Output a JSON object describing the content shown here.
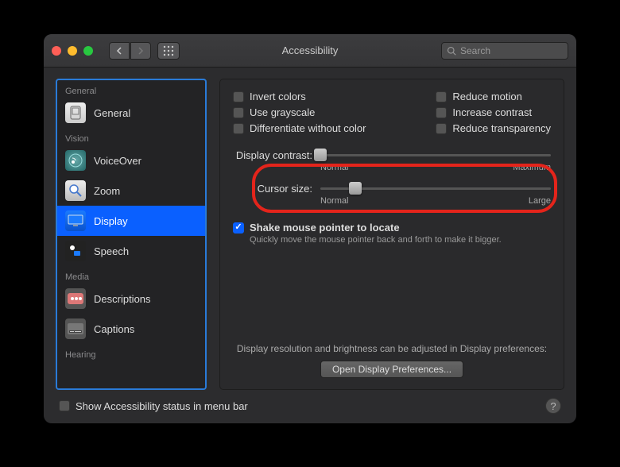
{
  "window": {
    "title": "Accessibility"
  },
  "search": {
    "placeholder": "Search"
  },
  "sidebar": {
    "sections": [
      {
        "header": "General",
        "items": [
          {
            "label": "General",
            "icon": "general",
            "selected": false
          }
        ]
      },
      {
        "header": "Vision",
        "items": [
          {
            "label": "VoiceOver",
            "icon": "voiceover",
            "selected": false
          },
          {
            "label": "Zoom",
            "icon": "zoom",
            "selected": false
          },
          {
            "label": "Display",
            "icon": "display",
            "selected": true
          },
          {
            "label": "Speech",
            "icon": "speech",
            "selected": false
          }
        ]
      },
      {
        "header": "Media",
        "items": [
          {
            "label": "Descriptions",
            "icon": "descriptions",
            "selected": false
          },
          {
            "label": "Captions",
            "icon": "captions",
            "selected": false
          }
        ]
      },
      {
        "header": "Hearing",
        "items": []
      }
    ]
  },
  "main": {
    "checkboxes_left": [
      {
        "label": "Invert colors",
        "checked": false
      },
      {
        "label": "Use grayscale",
        "checked": false
      },
      {
        "label": "Differentiate without color",
        "checked": false
      }
    ],
    "checkboxes_right": [
      {
        "label": "Reduce motion",
        "checked": false
      },
      {
        "label": "Increase contrast",
        "checked": false
      },
      {
        "label": "Reduce transparency",
        "checked": false
      }
    ],
    "contrast": {
      "label": "Display contrast:",
      "min_label": "Normal",
      "max_label": "Maximum",
      "value_pct": 0
    },
    "cursor": {
      "label": "Cursor size:",
      "min_label": "Normal",
      "max_label": "Large",
      "value_pct": 15
    },
    "shake": {
      "label": "Shake mouse pointer to locate",
      "checked": true,
      "hint": "Quickly move the mouse pointer back and forth to make it bigger."
    },
    "footer_note": "Display resolution and brightness can be adjusted in Display preferences:",
    "open_prefs_button": "Open Display Preferences..."
  },
  "bottom": {
    "status_checkbox": {
      "label": "Show Accessibility status in menu bar",
      "checked": false
    }
  }
}
